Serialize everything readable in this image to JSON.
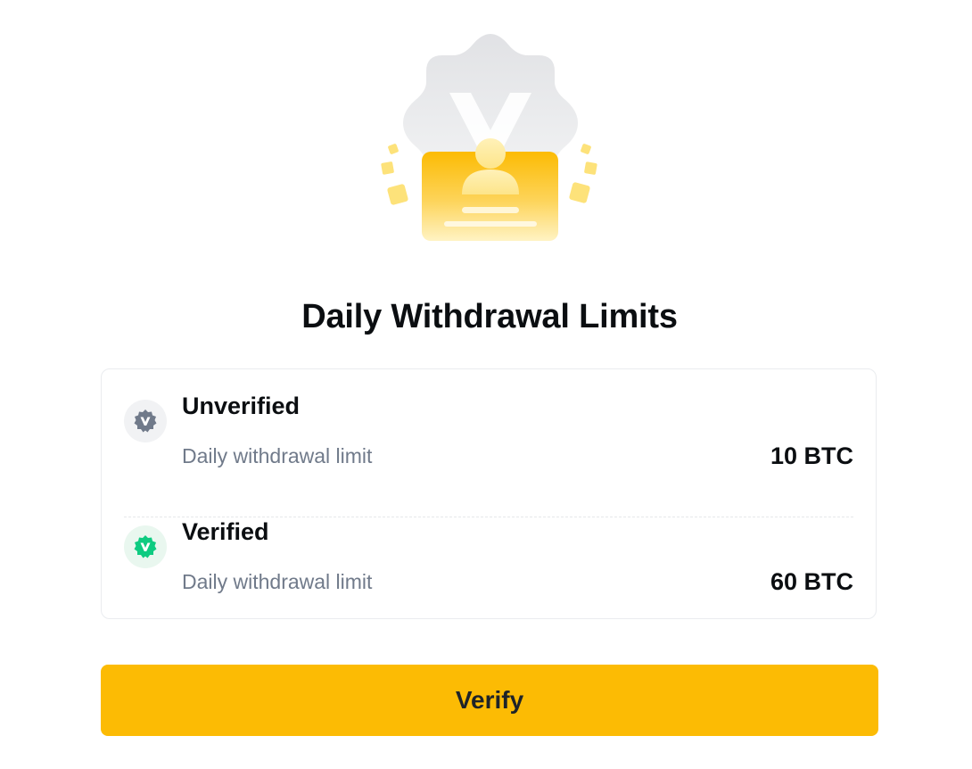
{
  "page": {
    "title": "Daily Withdrawal Limits"
  },
  "hero": {
    "icon": "verification-id-card-illustration"
  },
  "tiers": [
    {
      "name": "Unverified",
      "limit_label": "Daily withdrawal limit",
      "limit_value": "10 BTC",
      "badge_icon": "unverified-badge-icon",
      "badge_color": "#707a8a"
    },
    {
      "name": "Verified",
      "limit_label": "Daily withdrawal limit",
      "limit_value": "60 BTC",
      "badge_icon": "verified-badge-icon",
      "badge_color": "#0ecb81"
    }
  ],
  "actions": {
    "verify_label": "Verify"
  },
  "colors": {
    "accent": "#fcbb04",
    "text_primary": "#0b0e11",
    "text_secondary": "#707a8a",
    "verified_green": "#0ecb81"
  }
}
